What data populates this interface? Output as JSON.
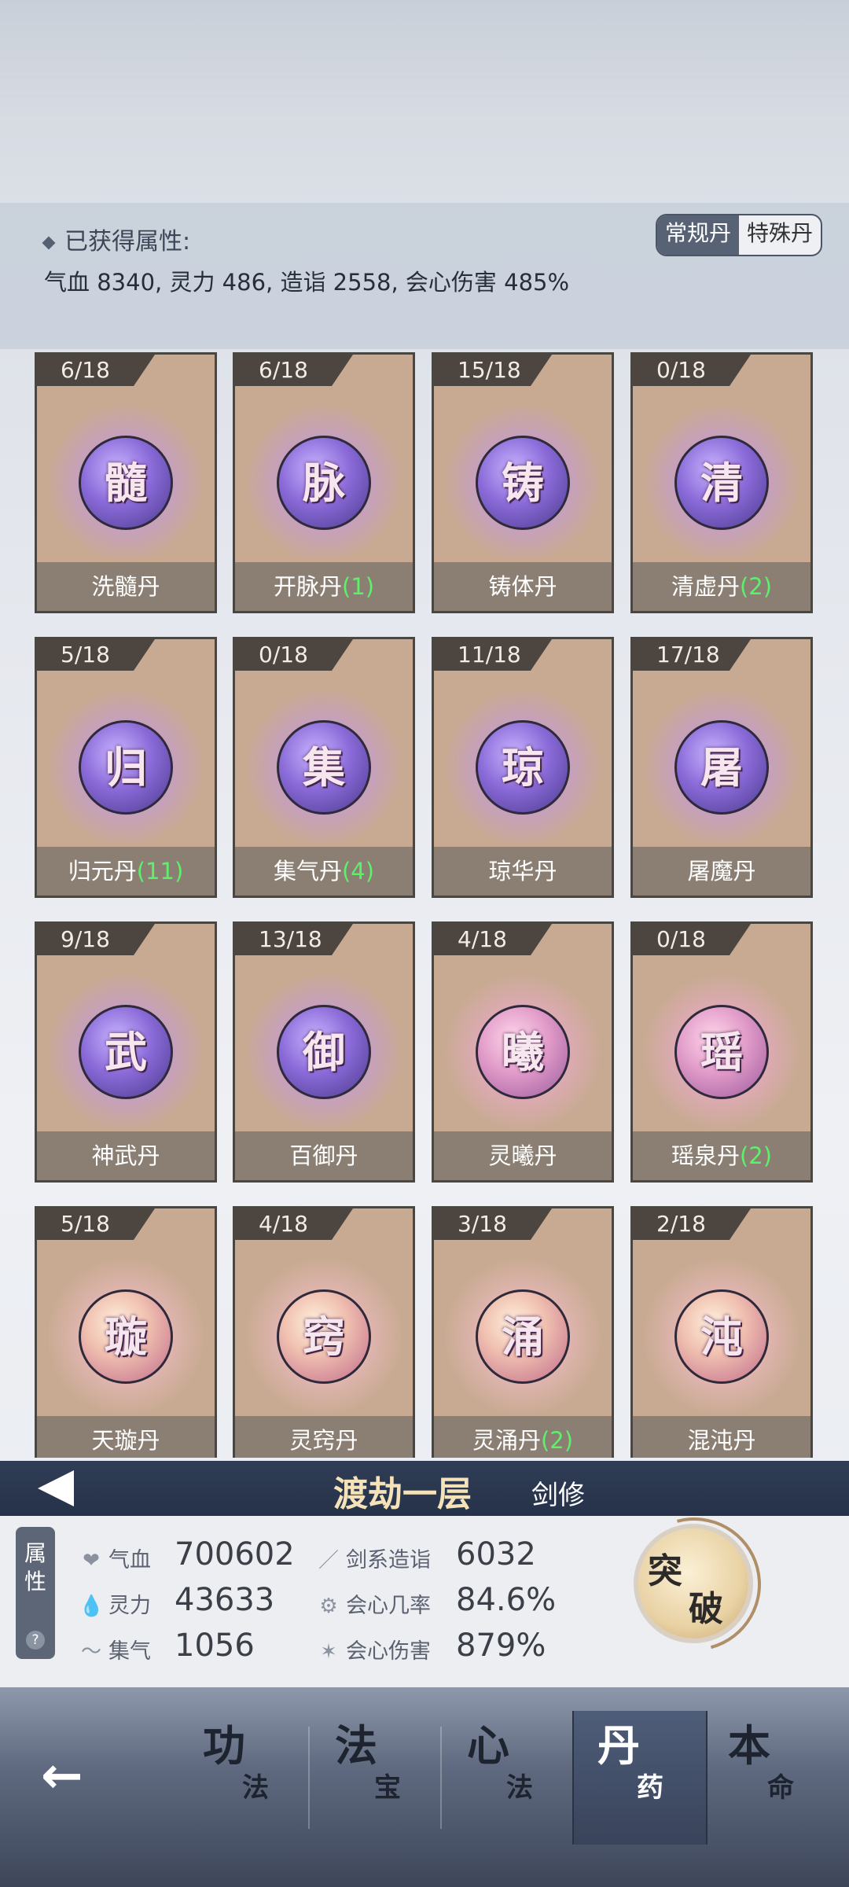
{
  "header": {
    "title": "已获得属性:",
    "values": "气血 8340, 灵力 486, 造诣 2558, 会心伤害 485%",
    "tabs": [
      {
        "label": "常规丹",
        "active": true
      },
      {
        "label": "特殊丹",
        "active": false
      }
    ]
  },
  "pills": [
    {
      "count": "6/18",
      "glyph": "髓",
      "name": "洗髓丹",
      "qty": "",
      "color": "purple"
    },
    {
      "count": "6/18",
      "glyph": "脉",
      "name": "开脉丹",
      "qty": "(1)",
      "color": "purple"
    },
    {
      "count": "15/18",
      "glyph": "铸",
      "name": "铸体丹",
      "qty": "",
      "color": "purple"
    },
    {
      "count": "0/18",
      "glyph": "清",
      "name": "清虚丹",
      "qty": "(2)",
      "color": "purple"
    },
    {
      "count": "5/18",
      "glyph": "归",
      "name": "归元丹",
      "qty": "(11)",
      "color": "purple"
    },
    {
      "count": "0/18",
      "glyph": "集",
      "name": "集气丹",
      "qty": "(4)",
      "color": "purple"
    },
    {
      "count": "11/18",
      "glyph": "琼",
      "name": "琼华丹",
      "qty": "",
      "color": "purple"
    },
    {
      "count": "17/18",
      "glyph": "屠",
      "name": "屠魔丹",
      "qty": "",
      "color": "purple"
    },
    {
      "count": "9/18",
      "glyph": "武",
      "name": "神武丹",
      "qty": "",
      "color": "purple"
    },
    {
      "count": "13/18",
      "glyph": "御",
      "name": "百御丹",
      "qty": "",
      "color": "purple"
    },
    {
      "count": "4/18",
      "glyph": "曦",
      "name": "灵曦丹",
      "qty": "",
      "color": "pink"
    },
    {
      "count": "0/18",
      "glyph": "瑶",
      "name": "瑶泉丹",
      "qty": "(2)",
      "color": "pink"
    },
    {
      "count": "5/18",
      "glyph": "璇",
      "name": "天璇丹",
      "qty": "",
      "color": "gold"
    },
    {
      "count": "4/18",
      "glyph": "窍",
      "name": "灵窍丹",
      "qty": "",
      "color": "gold"
    },
    {
      "count": "3/18",
      "glyph": "涌",
      "name": "灵涌丹",
      "qty": "(2)",
      "color": "gold"
    },
    {
      "count": "2/18",
      "glyph": "沌",
      "name": "混沌丹",
      "qty": "",
      "color": "gold"
    }
  ],
  "banner": {
    "realm": "渡劫一层",
    "sect": "剑修"
  },
  "stats": {
    "tag": "属性",
    "help": "?",
    "items": [
      {
        "icon": "❤",
        "label": "气血",
        "value": "700602"
      },
      {
        "icon": "💧",
        "label": "灵力",
        "value": "43633"
      },
      {
        "icon": "〜",
        "label": "集气",
        "value": "1056"
      },
      {
        "icon": "／",
        "label": "剑系造诣",
        "value": "6032"
      },
      {
        "icon": "⚙",
        "label": "会心几率",
        "value": "84.6%"
      },
      {
        "icon": "✶",
        "label": "会心伤害",
        "value": "879%"
      }
    ]
  },
  "breakthrough": {
    "char1": "突",
    "char2": "破"
  },
  "nav": {
    "back": "←",
    "tabs": [
      {
        "big": "功",
        "small": "法",
        "active": false
      },
      {
        "big": "法",
        "small": "宝",
        "active": false
      },
      {
        "big": "心",
        "small": "法",
        "active": false
      },
      {
        "big": "丹",
        "small": "药",
        "active": true
      },
      {
        "big": "本",
        "small": "命",
        "active": false
      }
    ]
  }
}
